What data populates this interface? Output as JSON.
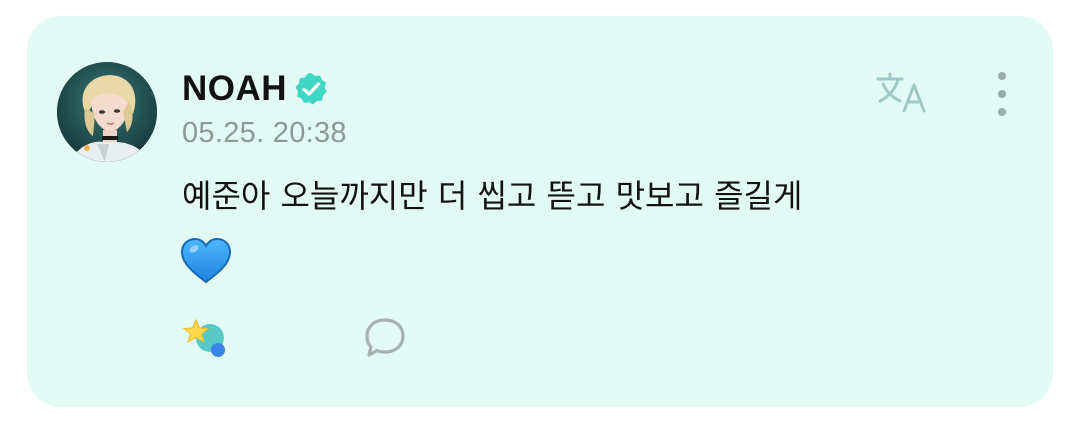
{
  "post": {
    "author": "NOAH",
    "verified": true,
    "timestamp": "05.25. 20:38",
    "message": "예준아 오늘까지만 더 씹고 뜯고 맛보고 즐길게",
    "emoji": "blue-heart"
  },
  "icons": {
    "avatar": "profile-avatar",
    "verified": "verified-badge-icon",
    "translate": "translate-icon",
    "more": "more-vertical-icon",
    "reaction": "star-reaction-icon",
    "comment": "comment-bubble-icon"
  },
  "colors": {
    "card_background": "#e3fbf5",
    "verified_badge": "#3fd6c4",
    "translate_icon": "#9ec9c4",
    "more_icon": "#98ada9",
    "comment_icon": "#a7b2b0",
    "heart": "#2d9bf0"
  }
}
